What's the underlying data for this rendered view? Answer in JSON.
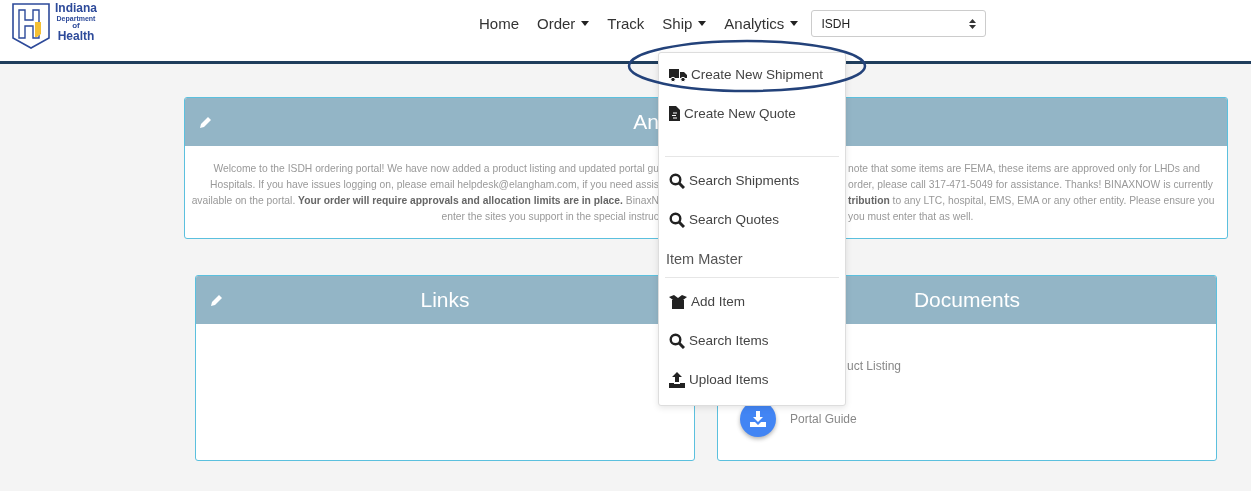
{
  "logo": {
    "line1": "Indiana",
    "line2": "Department",
    "line3": "of",
    "line4": "Health"
  },
  "nav": [
    {
      "label": "Home",
      "dropdown": false
    },
    {
      "label": "Order",
      "dropdown": true
    },
    {
      "label": "Track",
      "dropdown": false
    },
    {
      "label": "Ship",
      "dropdown": true
    },
    {
      "label": "Analytics",
      "dropdown": true
    }
  ],
  "site_select": {
    "value": "ISDH"
  },
  "ship_menu": [
    {
      "kind": "item",
      "label": "Create New Shipment"
    },
    {
      "kind": "item",
      "label": "Create New Quote"
    },
    {
      "kind": "divider"
    },
    {
      "kind": "item",
      "label": "Search Shipments"
    },
    {
      "kind": "item",
      "label": "Search Quotes"
    },
    {
      "kind": "header",
      "label": "Item Master"
    },
    {
      "kind": "divider"
    },
    {
      "kind": "item",
      "label": "Add Item"
    },
    {
      "kind": "item",
      "label": "Search Items"
    },
    {
      "kind": "item",
      "label": "Upload Items"
    }
  ],
  "announcement": {
    "title_visible": "An",
    "left_lines": [
      "Welcome to the ISDH ordering portal! We have now added a product listing and updated portal gu",
      "Hospitals. If you have issues logging on, please email helpdesk@elangham.com, if you need assis",
      "available on the portal. **Your order will require approvals and allocation limits are in place.** BinaxN",
      "enter the sites you support in the special instruc"
    ],
    "right_lines": [
      "note that some items are FEMA, these items are approved only for LHDs and",
      "order, please call 317-471-5049 for assistance. Thanks! BINAXNOW is currently",
      "**tribution** to any LTC, hospital, EMS, EMA or any other entity. Please ensure you",
      "you must enter that as well."
    ]
  },
  "links": {
    "title": "Links"
  },
  "documents": {
    "title": "Documents",
    "items": [
      {
        "kind": "covered",
        "label": "uct Listing"
      },
      {
        "kind": "download",
        "label": "Portal Guide"
      }
    ]
  }
}
